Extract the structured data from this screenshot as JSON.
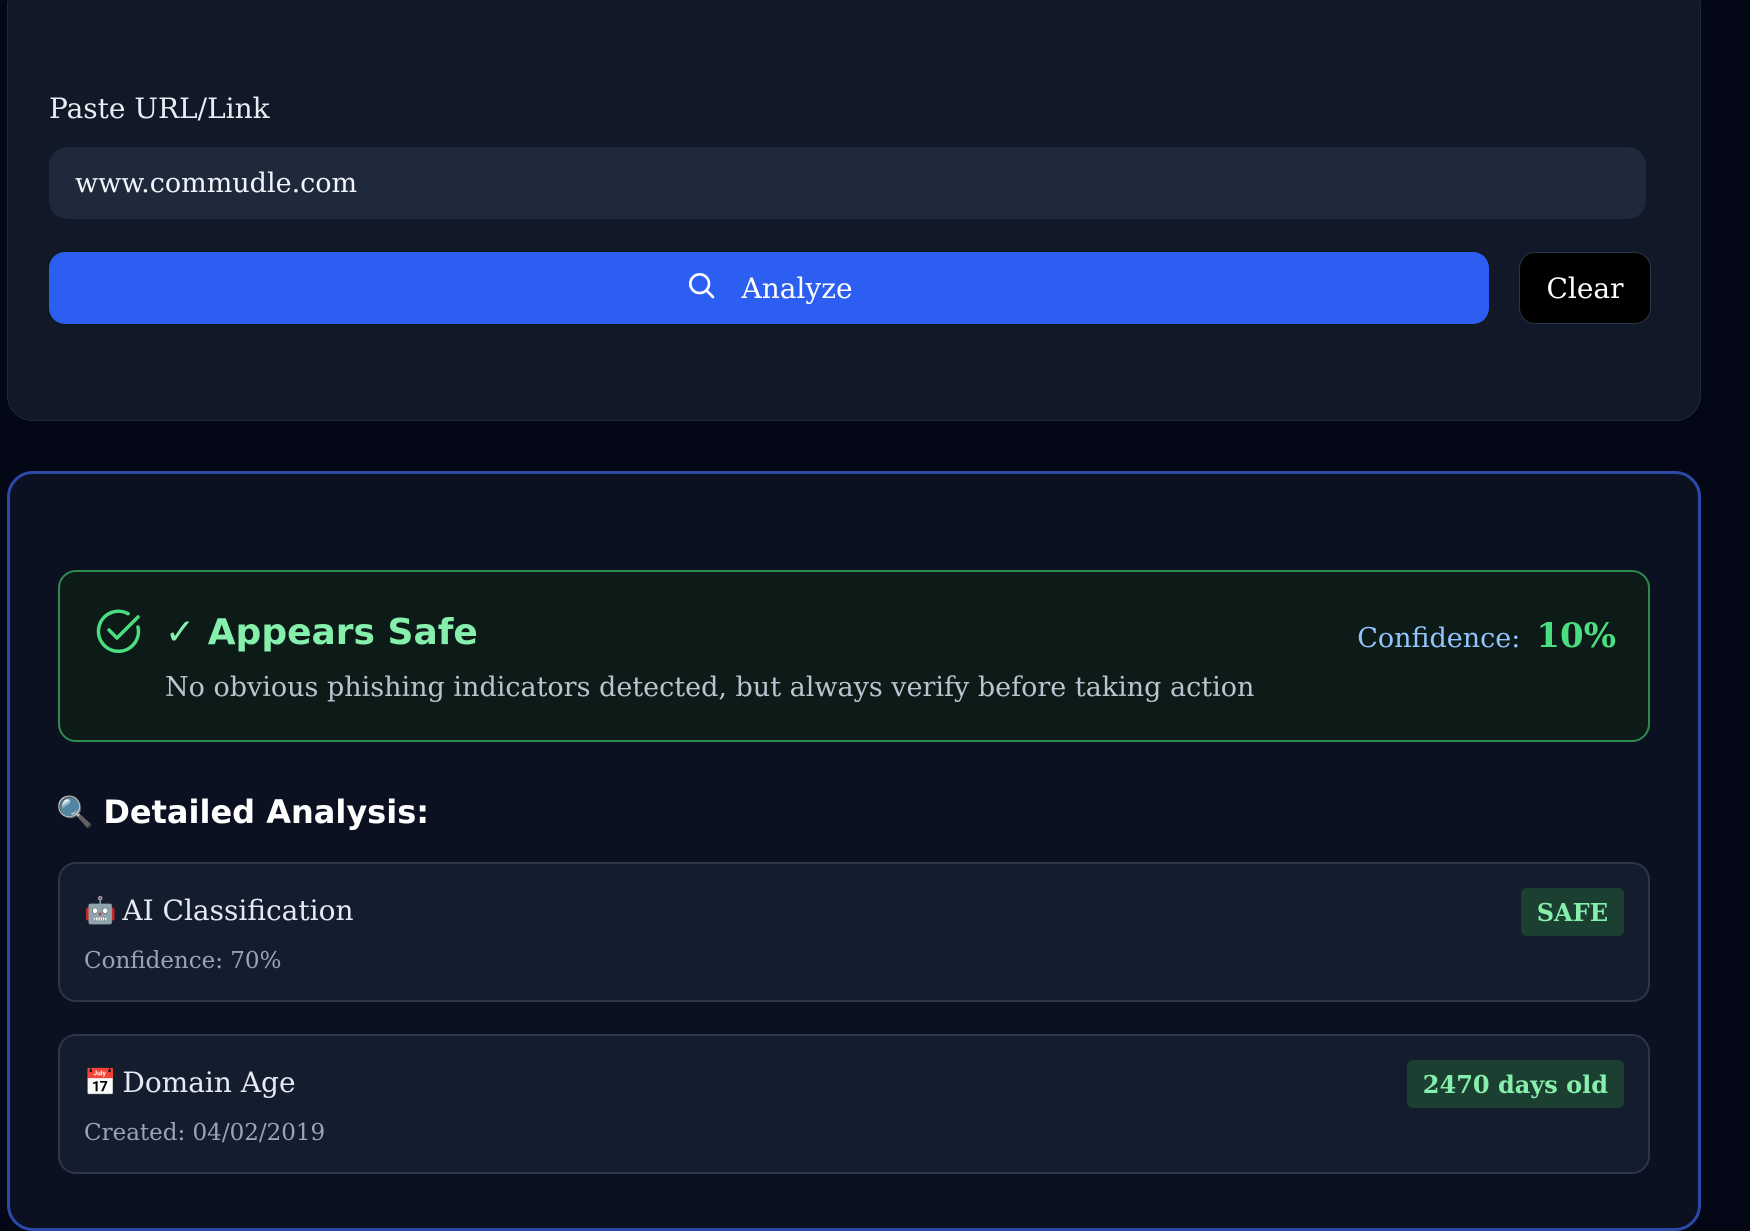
{
  "input": {
    "label": "Paste URL/Link",
    "value": "www.commudle.com",
    "placeholder": ""
  },
  "actions": {
    "analyze_label": "Analyze",
    "analyze_icon": "search-icon",
    "clear_label": "Clear"
  },
  "verdict": {
    "title": "✓ Appears Safe",
    "description": "No obvious phishing indicators detected, but always verify before taking action",
    "confidence_label": "Confidence:",
    "confidence_value": "10%",
    "icon": "check-circle-icon",
    "color": "#86efac"
  },
  "analysis": {
    "title": "Detailed Analysis:",
    "title_icon": "🔍",
    "items": [
      {
        "icon": "🤖",
        "title": "AI Classification",
        "subtitle": "Confidence: 70%",
        "badge": "SAFE"
      },
      {
        "icon": "📅",
        "title": "Domain Age",
        "subtitle": "Created: 04/02/2019",
        "badge": "2470 days old"
      }
    ]
  },
  "colors": {
    "accent": "#2d5ef2",
    "success": "#4ade80",
    "background": "#040816"
  }
}
